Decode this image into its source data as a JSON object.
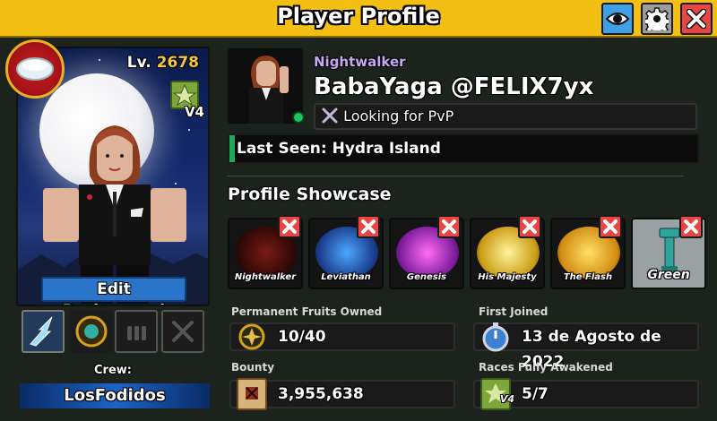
{
  "header": {
    "title": "Player Profile"
  },
  "avatar_panel": {
    "level_prefix": "Lv.",
    "level": "2678",
    "race_version": "V4",
    "edit_background_label": "Edit Background"
  },
  "crew": {
    "label": "Crew:",
    "name": "LosFodidos"
  },
  "profile": {
    "title": "Nightwalker",
    "display_name": "BabaYaga",
    "username": "@FELIX7yx",
    "status": "Looking for PvP",
    "last_seen_label": "Last Seen:",
    "last_seen_location": "Hydra Island"
  },
  "showcase": {
    "title": "Profile Showcase",
    "items": [
      {
        "caption": "Nightwalker"
      },
      {
        "caption": "Leviathan"
      },
      {
        "caption": "Genesis"
      },
      {
        "caption": "His Majesty"
      },
      {
        "caption": "The Flash"
      },
      {
        "caption": "Green"
      }
    ]
  },
  "stats": {
    "fruits_label": "Permanent Fruits Owned",
    "fruits_value": "10/40",
    "joined_label": "First Joined",
    "joined_value": "13 de Agosto de 2022",
    "bounty_label": "Bounty",
    "bounty_value": "3,955,638",
    "races_label": "Races Fully Awakened",
    "races_value": "5/7",
    "races_version": "V4"
  },
  "colors": {
    "header": "#f2bf12",
    "close": "#e84545",
    "eye": "#3fa0e6",
    "online": "#1fc35b",
    "level": "#f6c543",
    "title_text": "#c8a8f5"
  }
}
